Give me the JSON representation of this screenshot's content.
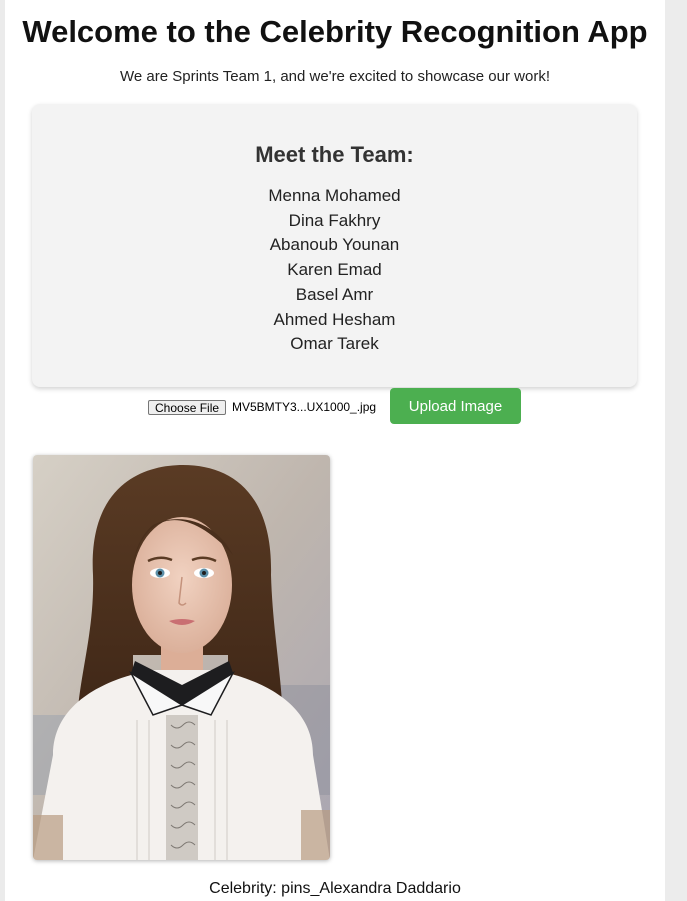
{
  "header": {
    "title": "Welcome to the Celebrity Recognition App",
    "subtitle": "We are Sprints Team 1, and we're excited to showcase our work!"
  },
  "team": {
    "heading": "Meet the Team:",
    "members": [
      "Menna Mohamed",
      "Dina Fakhry",
      "Abanoub Younan",
      "Karen Emad",
      "Basel Amr",
      "Ahmed Hesham",
      "Omar Tarek"
    ]
  },
  "upload": {
    "choose_label": "Choose File",
    "file_name": "MV5BMTY3...UX1000_.jpg",
    "button_label": "Upload Image"
  },
  "result": {
    "text": "Celebrity: pins_Alexandra Daddario"
  },
  "colors": {
    "accent": "#4caf50",
    "card_bg": "#f3f3f3"
  }
}
